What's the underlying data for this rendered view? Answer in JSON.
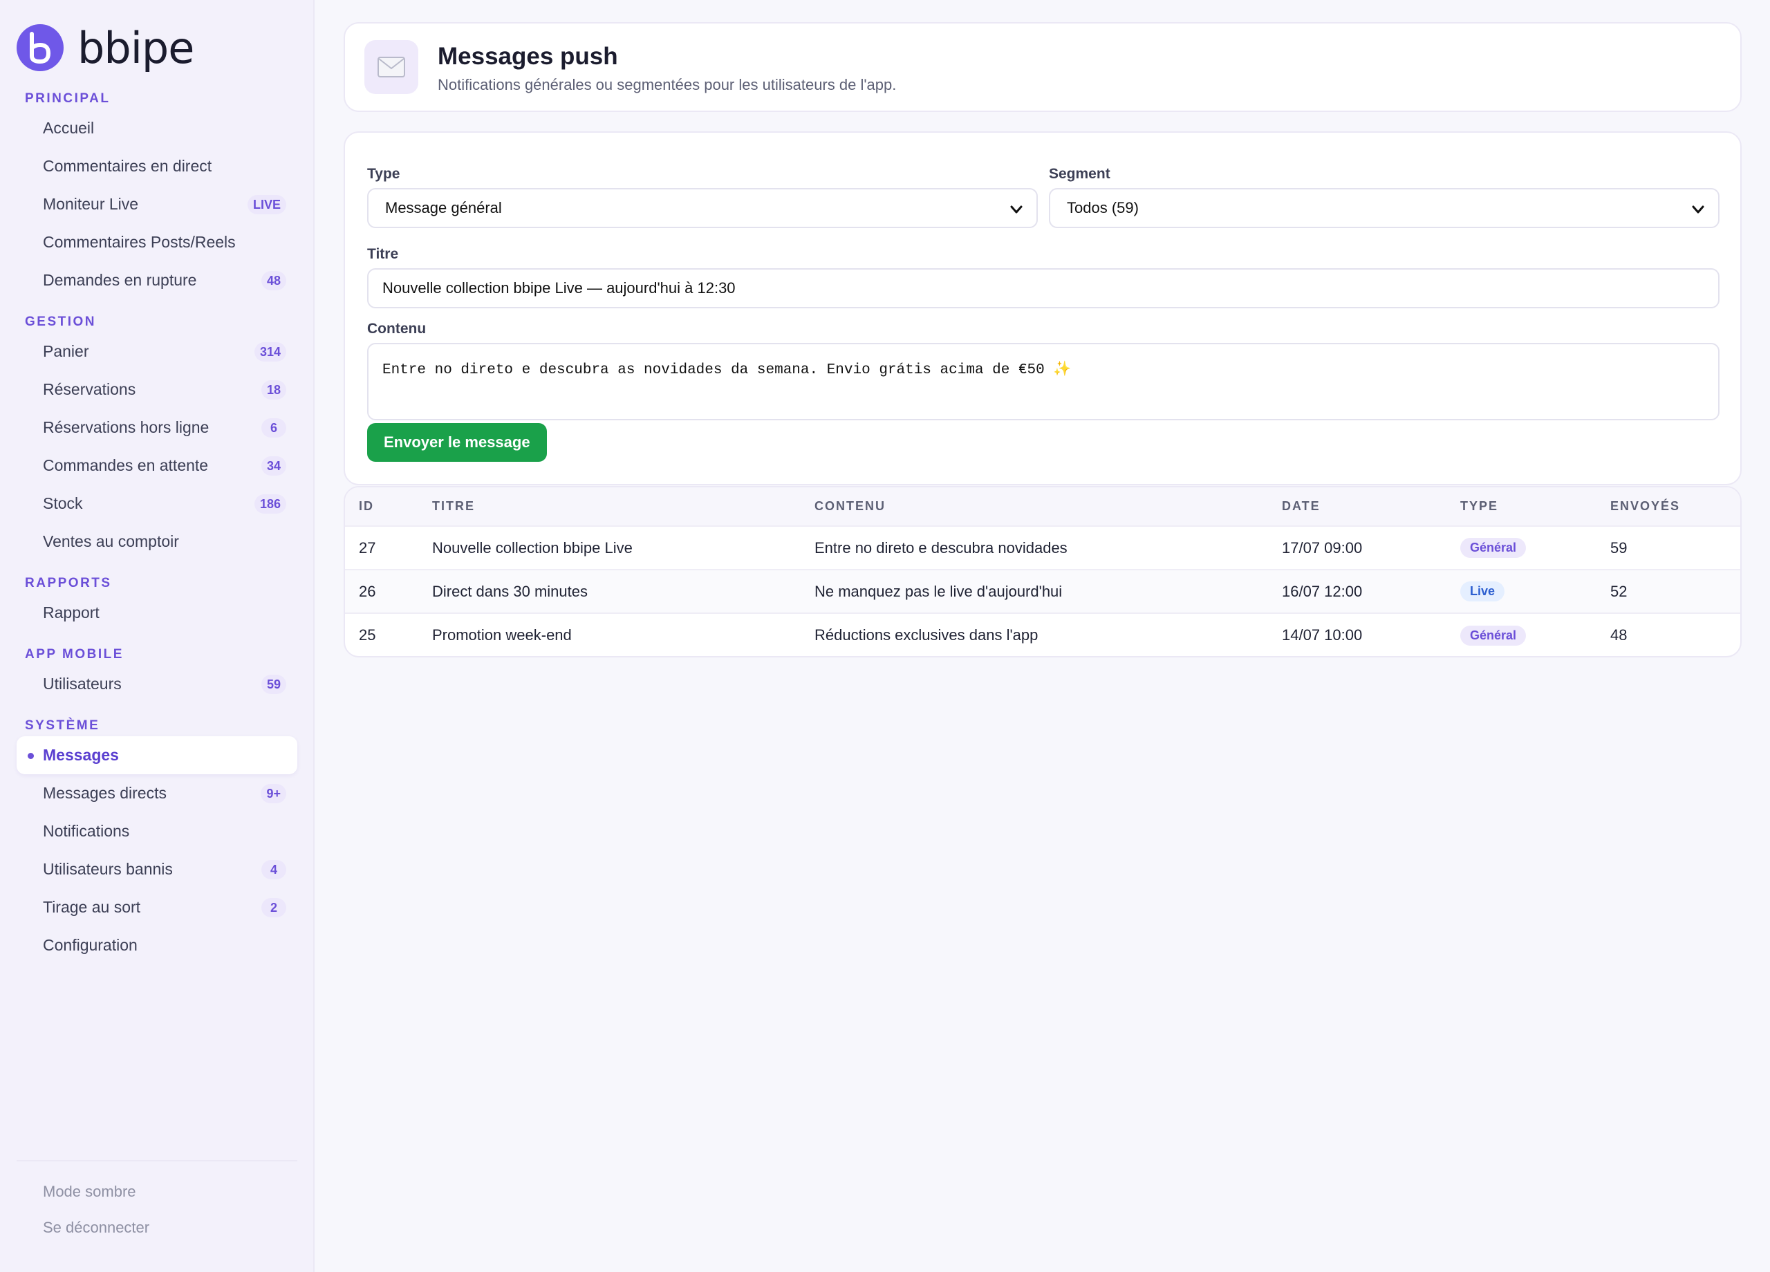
{
  "brand": {
    "name": "bbipe"
  },
  "sidebar": {
    "sections": [
      {
        "label": "PRINCIPAL",
        "items": [
          {
            "label": "Accueil",
            "badge": ""
          },
          {
            "label": "Commentaires en direct",
            "badge": ""
          },
          {
            "label": "Moniteur Live",
            "badge": "LIVE"
          },
          {
            "label": "Commentaires Posts/Reels",
            "badge": ""
          },
          {
            "label": "Demandes en rupture",
            "badge": "48"
          }
        ]
      },
      {
        "label": "GESTION",
        "items": [
          {
            "label": "Panier",
            "badge": "314"
          },
          {
            "label": "Réservations",
            "badge": "18"
          },
          {
            "label": "Réservations hors ligne",
            "badge": "6"
          },
          {
            "label": "Commandes en attente",
            "badge": "34"
          },
          {
            "label": "Stock",
            "badge": "186"
          },
          {
            "label": "Ventes au comptoir",
            "badge": ""
          }
        ]
      },
      {
        "label": "RAPPORTS",
        "items": [
          {
            "label": "Rapport",
            "badge": ""
          }
        ]
      },
      {
        "label": "APP MOBILE",
        "items": [
          {
            "label": "Utilisateurs",
            "badge": "59"
          }
        ]
      },
      {
        "label": "SYSTÈME",
        "items": [
          {
            "label": "Messages",
            "badge": "",
            "active": true
          },
          {
            "label": "Messages directs",
            "badge": "9+"
          },
          {
            "label": "Notifications",
            "badge": ""
          },
          {
            "label": "Utilisateurs bannis",
            "badge": "4"
          },
          {
            "label": "Tirage au sort",
            "badge": "2"
          },
          {
            "label": "Configuration",
            "badge": ""
          }
        ]
      }
    ],
    "footer": {
      "dark_mode": "Mode sombre",
      "logout": "Se déconnecter"
    }
  },
  "header": {
    "icon": "envelope-icon",
    "title": "Messages push",
    "subtitle": "Notifications générales ou segmentées pour les utilisateurs de l'app."
  },
  "form": {
    "type_label": "Type",
    "type_value": "Message général",
    "segment_label": "Segment",
    "segment_value": "Todos (59)",
    "title_label": "Titre",
    "title_value": "Nouvelle collection bbipe Live — aujourd'hui à 12:30",
    "content_label": "Contenu",
    "content_value": "Entre no direto e descubra as novidades da semana. Envio grátis acima de €50",
    "content_emoji": "✨",
    "send_label": "Envoyer le message"
  },
  "table": {
    "columns": [
      "ID",
      "TITRE",
      "CONTENU",
      "DATE",
      "TYPE",
      "ENVOYÉS"
    ],
    "rows": [
      {
        "id": "27",
        "title": "Nouvelle collection bbipe Live",
        "content": "Entre no direto e descubra novidades",
        "date": "17/07 09:00",
        "type": "Général",
        "type_kind": "general",
        "sent": "59"
      },
      {
        "id": "26",
        "title": "Direct dans 30 minutes",
        "content": "Ne manquez pas le live d'aujourd'hui",
        "date": "16/07 12:00",
        "type": "Live",
        "type_kind": "live",
        "sent": "52"
      },
      {
        "id": "25",
        "title": "Promotion week-end",
        "content": "Réductions exclusives dans l'app",
        "date": "14/07 10:00",
        "type": "Général",
        "type_kind": "general",
        "sent": "48"
      }
    ]
  },
  "colors": {
    "accent": "#6b4fd8",
    "success": "#1aa14a",
    "live_badge": "#2d5fd0"
  }
}
